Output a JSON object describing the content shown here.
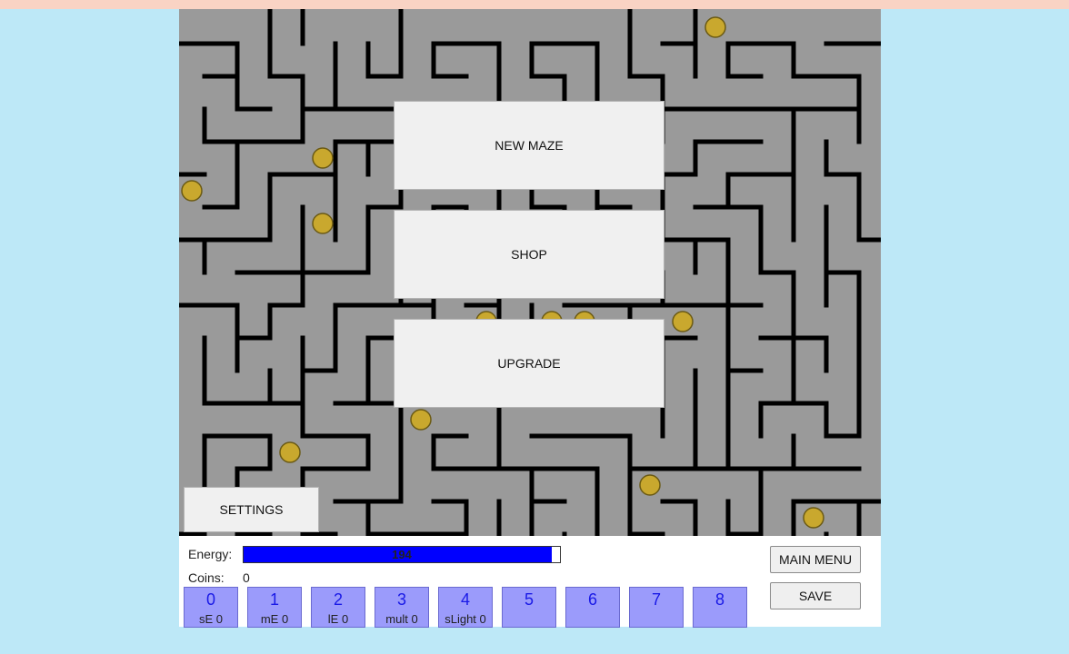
{
  "menu": {
    "new_maze": "NEW MAZE",
    "shop": "SHOP",
    "upgrade": "UPGRADE",
    "settings": "SETTINGS"
  },
  "hud": {
    "energy_label": "Energy:",
    "energy_value": "194",
    "energy_fraction": 0.975,
    "coins_label": "Coins:",
    "coins_value": "0",
    "main_menu": "MAIN MENU",
    "save": "SAVE"
  },
  "slots": [
    {
      "num": "0",
      "label": "sE 0"
    },
    {
      "num": "1",
      "label": "mE 0"
    },
    {
      "num": "2",
      "label": "lE 0"
    },
    {
      "num": "3",
      "label": "mult 0"
    },
    {
      "num": "4",
      "label": "sLight 0"
    },
    {
      "num": "5",
      "label": ""
    },
    {
      "num": "6",
      "label": ""
    },
    {
      "num": "7",
      "label": ""
    },
    {
      "num": "8",
      "label": ""
    }
  ],
  "colors": {
    "maze_floor": "#9a9a9a",
    "maze_wall": "#000000",
    "coin": "#c9a82e",
    "energy_bar": "#0000ff",
    "slot_bg": "#9b9bfb",
    "page_bg": "#bde8f7"
  }
}
